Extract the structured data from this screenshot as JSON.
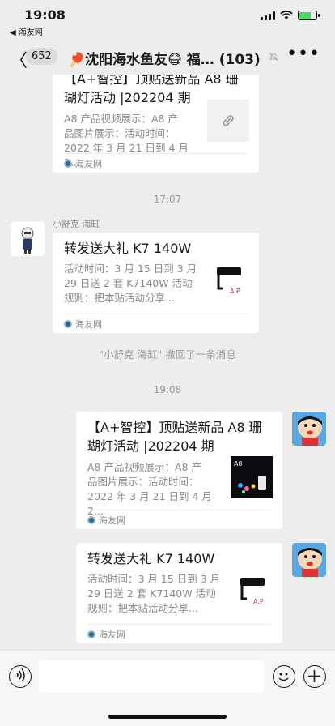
{
  "status_bar": {
    "time": "19:08",
    "back_app": "◀ 海友网"
  },
  "nav": {
    "back_glyph": "〈",
    "unread_count": "652",
    "title": "🏓沈阳海水鱼友😷 福…",
    "member_count": "(103)"
  },
  "messages": {
    "card1": {
      "title_top": "【A+智控】顶贴送新品 A8 珊",
      "title_bottom": "瑚灯活动 |202204 期",
      "desc1": "A8 产品视频展示：A8 产",
      "desc2": "品图片展示：活动时间：",
      "desc3": "2022 年 3 月 21 日到 4 月 2...",
      "source": "海友网",
      "thumb_icon": "link-icon"
    },
    "time1": "17:07",
    "sender2": "小舒克 海缸",
    "card2": {
      "title": "转发送大礼  K7 140W",
      "desc1": "活动时间：3 月 15 日到 3 月",
      "desc2": "29 日送 2 套 K7140W 活动",
      "desc3": "规则：把本贴活动分享...",
      "source": "海友网"
    },
    "recall": "\"小舒克 海缸\" 撤回了一条消息",
    "time2": "19:08",
    "card3": {
      "title1": "【A+智控】顶贴送新品 A8 珊",
      "title2": "瑚灯活动 |202204 期",
      "desc1": "A8 产品视频展示：A8 产",
      "desc2": "品图片展示：活动时间：",
      "desc3": "2022 年 3 月 21 日到 4 月 2...",
      "source": "海友网",
      "thumb_label": "A8"
    },
    "card4": {
      "title": "转发送大礼  K7 140W",
      "desc1": "活动时间：3 月 15 日到 3 月",
      "desc2": "29 日送 2 套 K7140W 活动",
      "desc3": "规则：把本贴活动分享...",
      "source": "海友网"
    }
  },
  "input_bar": {
    "icons": [
      "voice-icon",
      "emoji-icon",
      "plus-icon"
    ],
    "placeholder": ""
  },
  "colors": {
    "background": "#ededed",
    "card": "#ffffff",
    "battery": "#4cd964"
  }
}
